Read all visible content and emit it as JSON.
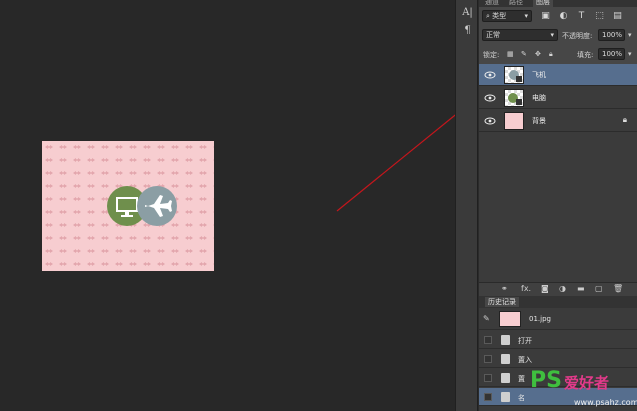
{
  "canvas": {
    "document_bg": "#f7cdd0",
    "pattern_color": "#e3a6ad",
    "icon_monitor_bg": "#6f8f4c",
    "icon_plane_bg": "#8b9ea4"
  },
  "panel_tabs": [
    "通道",
    "路径",
    "图层"
  ],
  "filter": {
    "kind_label": "类型"
  },
  "blend": {
    "mode": "正常",
    "opacity_label": "不透明度:",
    "opacity_value": "100%"
  },
  "lock": {
    "label": "锁定:",
    "fill_label": "填充:",
    "fill_value": "100%"
  },
  "layers": [
    {
      "name": "飞机",
      "selected": true,
      "locked": false
    },
    {
      "name": "电脑",
      "selected": false,
      "locked": false
    },
    {
      "name": "背景",
      "selected": false,
      "locked": true
    }
  ],
  "layer_tools": [
    "link-icon",
    "fx-icon",
    "mask-icon",
    "adjustment-icon",
    "group-icon",
    "new-layer-icon",
    "trash-icon"
  ],
  "fx_label": "fx.",
  "history": {
    "title": "历史记录",
    "snapshot": "01.jpg",
    "items": [
      "打开",
      "置入",
      "置",
      "名"
    ]
  },
  "watermark": {
    "brand": "PS",
    "cn": "爱好者",
    "url": "www.psahz.com"
  },
  "colors": {
    "arrow": "#c4161c",
    "selection": "#566e8e"
  }
}
